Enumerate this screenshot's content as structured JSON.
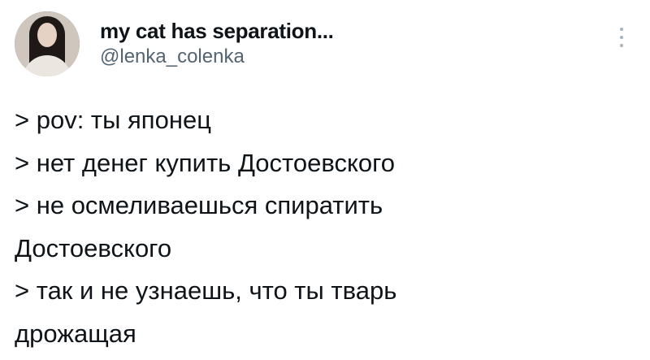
{
  "tweet": {
    "display_name": "my cat has separation...",
    "handle": "@lenka_colenka",
    "more_icon": "more-vertical-icon",
    "lines": [
      "> pov: ты японец",
      "> нет денег купить Достоевского",
      "> не осмеливаешься спиратить",
      "Достоевского",
      "> так и не узнаешь, что ты тварь",
      "дрожащая"
    ]
  }
}
